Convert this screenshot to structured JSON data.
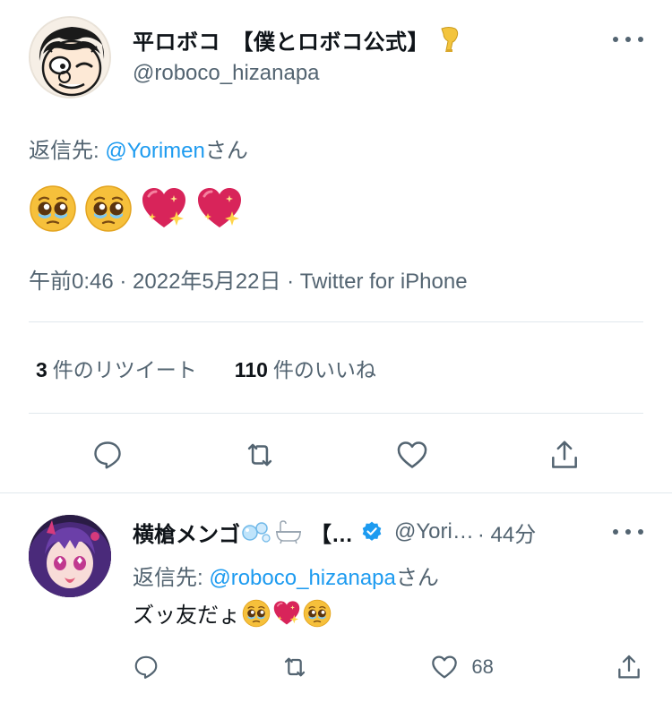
{
  "main_tweet": {
    "display_name": "平ロボコ　【僕とロボコ公式】",
    "handle": "@roboco_hizanapa",
    "reply_prefix": "返信先: ",
    "reply_mention": "@Yorimen",
    "reply_suffix": "さん",
    "body_emojis": [
      "pleading-face",
      "pleading-face",
      "sparkling-heart",
      "sparkling-heart"
    ],
    "timestamp": "午前0:46 · 2022年5月22日 · Twitter for iPhone",
    "retweet_count": "3",
    "retweet_label": "件のリツイート",
    "like_count": "110",
    "like_label": "件のいいね"
  },
  "reply_tweet": {
    "display_name": "横槍メンゴ",
    "name_suffix": "【…",
    "handle": "@Yori…",
    "time": "· 44分",
    "reply_prefix": "返信先: ",
    "reply_mention": "@roboco_hizanapa",
    "reply_suffix": "さん",
    "body_text": "ズッ友だょ",
    "body_emojis": [
      "pleading-face",
      "sparkling-heart",
      "pleading-face"
    ],
    "like_count": "68"
  },
  "colors": {
    "accent": "#1d9bf0",
    "secondary_text": "#536471",
    "divider": "#e1e8ed",
    "verified": "#1d9bf0"
  },
  "icons": {
    "reply": "reply-icon",
    "retweet": "retweet-icon",
    "like": "heart-icon",
    "share": "share-icon",
    "more": "more-icon"
  }
}
